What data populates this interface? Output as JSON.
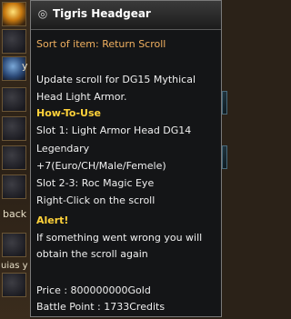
{
  "background": {
    "back_label": "back",
    "y_label": "y",
    "bottom_label": "uias y"
  },
  "tooltip": {
    "title_icon": "bullet-icon",
    "title": "Tigris Headgear",
    "sort_label": "Sort of item: Return Scroll",
    "description": [
      "Update scroll for DG15 Mythical",
      "Head Light Armor."
    ],
    "howto_heading": "How-To-Use",
    "howto_lines": [
      "Slot 1: Light Armor Head DG14",
      "Legendary",
      "+7(Euro/CH/Male/Femele)",
      "Slot 2-3: Roc Magic Eye",
      "Right-Click on the scroll"
    ],
    "alert_heading": "Alert!",
    "alert_lines": [
      "If something went wrong you will",
      "obtain the scroll again"
    ],
    "price": "Price : 800000000Gold",
    "battle_point": "Battle Point : 1733Credits"
  }
}
